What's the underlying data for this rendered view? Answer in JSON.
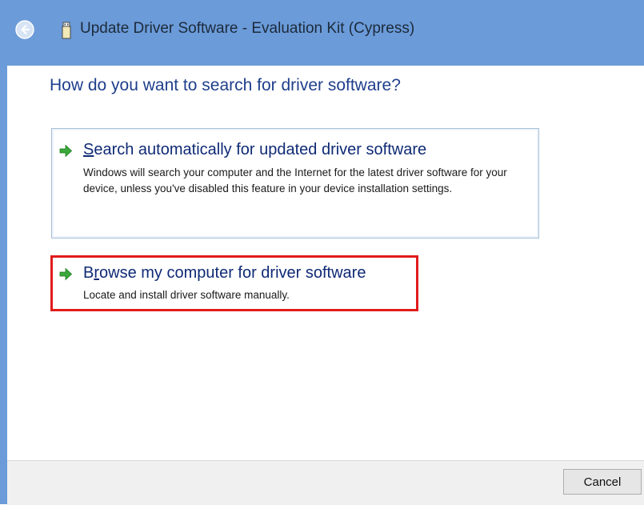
{
  "window": {
    "title": "Update Driver Software - Evaluation Kit (Cypress)",
    "accent_color": "#6b9bd9",
    "back_icon": "back-arrow-icon",
    "device_icon": "usb-device-icon"
  },
  "main": {
    "heading": "How do you want to search for driver software?",
    "options": [
      {
        "title_access_key": "S",
        "title_rest": "earch automatically for updated driver software",
        "description": "Windows will search your computer and the Internet for the latest driver software for your device, unless you've disabled this feature in your device installation settings.",
        "icon": "green-arrow-icon"
      },
      {
        "title_prefix": "B",
        "title_access_key": "r",
        "title_rest": "owse my computer for driver software",
        "description": "Locate and install driver software manually.",
        "icon": "green-arrow-icon",
        "highlight_color": "#e11b1b"
      }
    ]
  },
  "footer": {
    "cancel_label": "Cancel"
  }
}
